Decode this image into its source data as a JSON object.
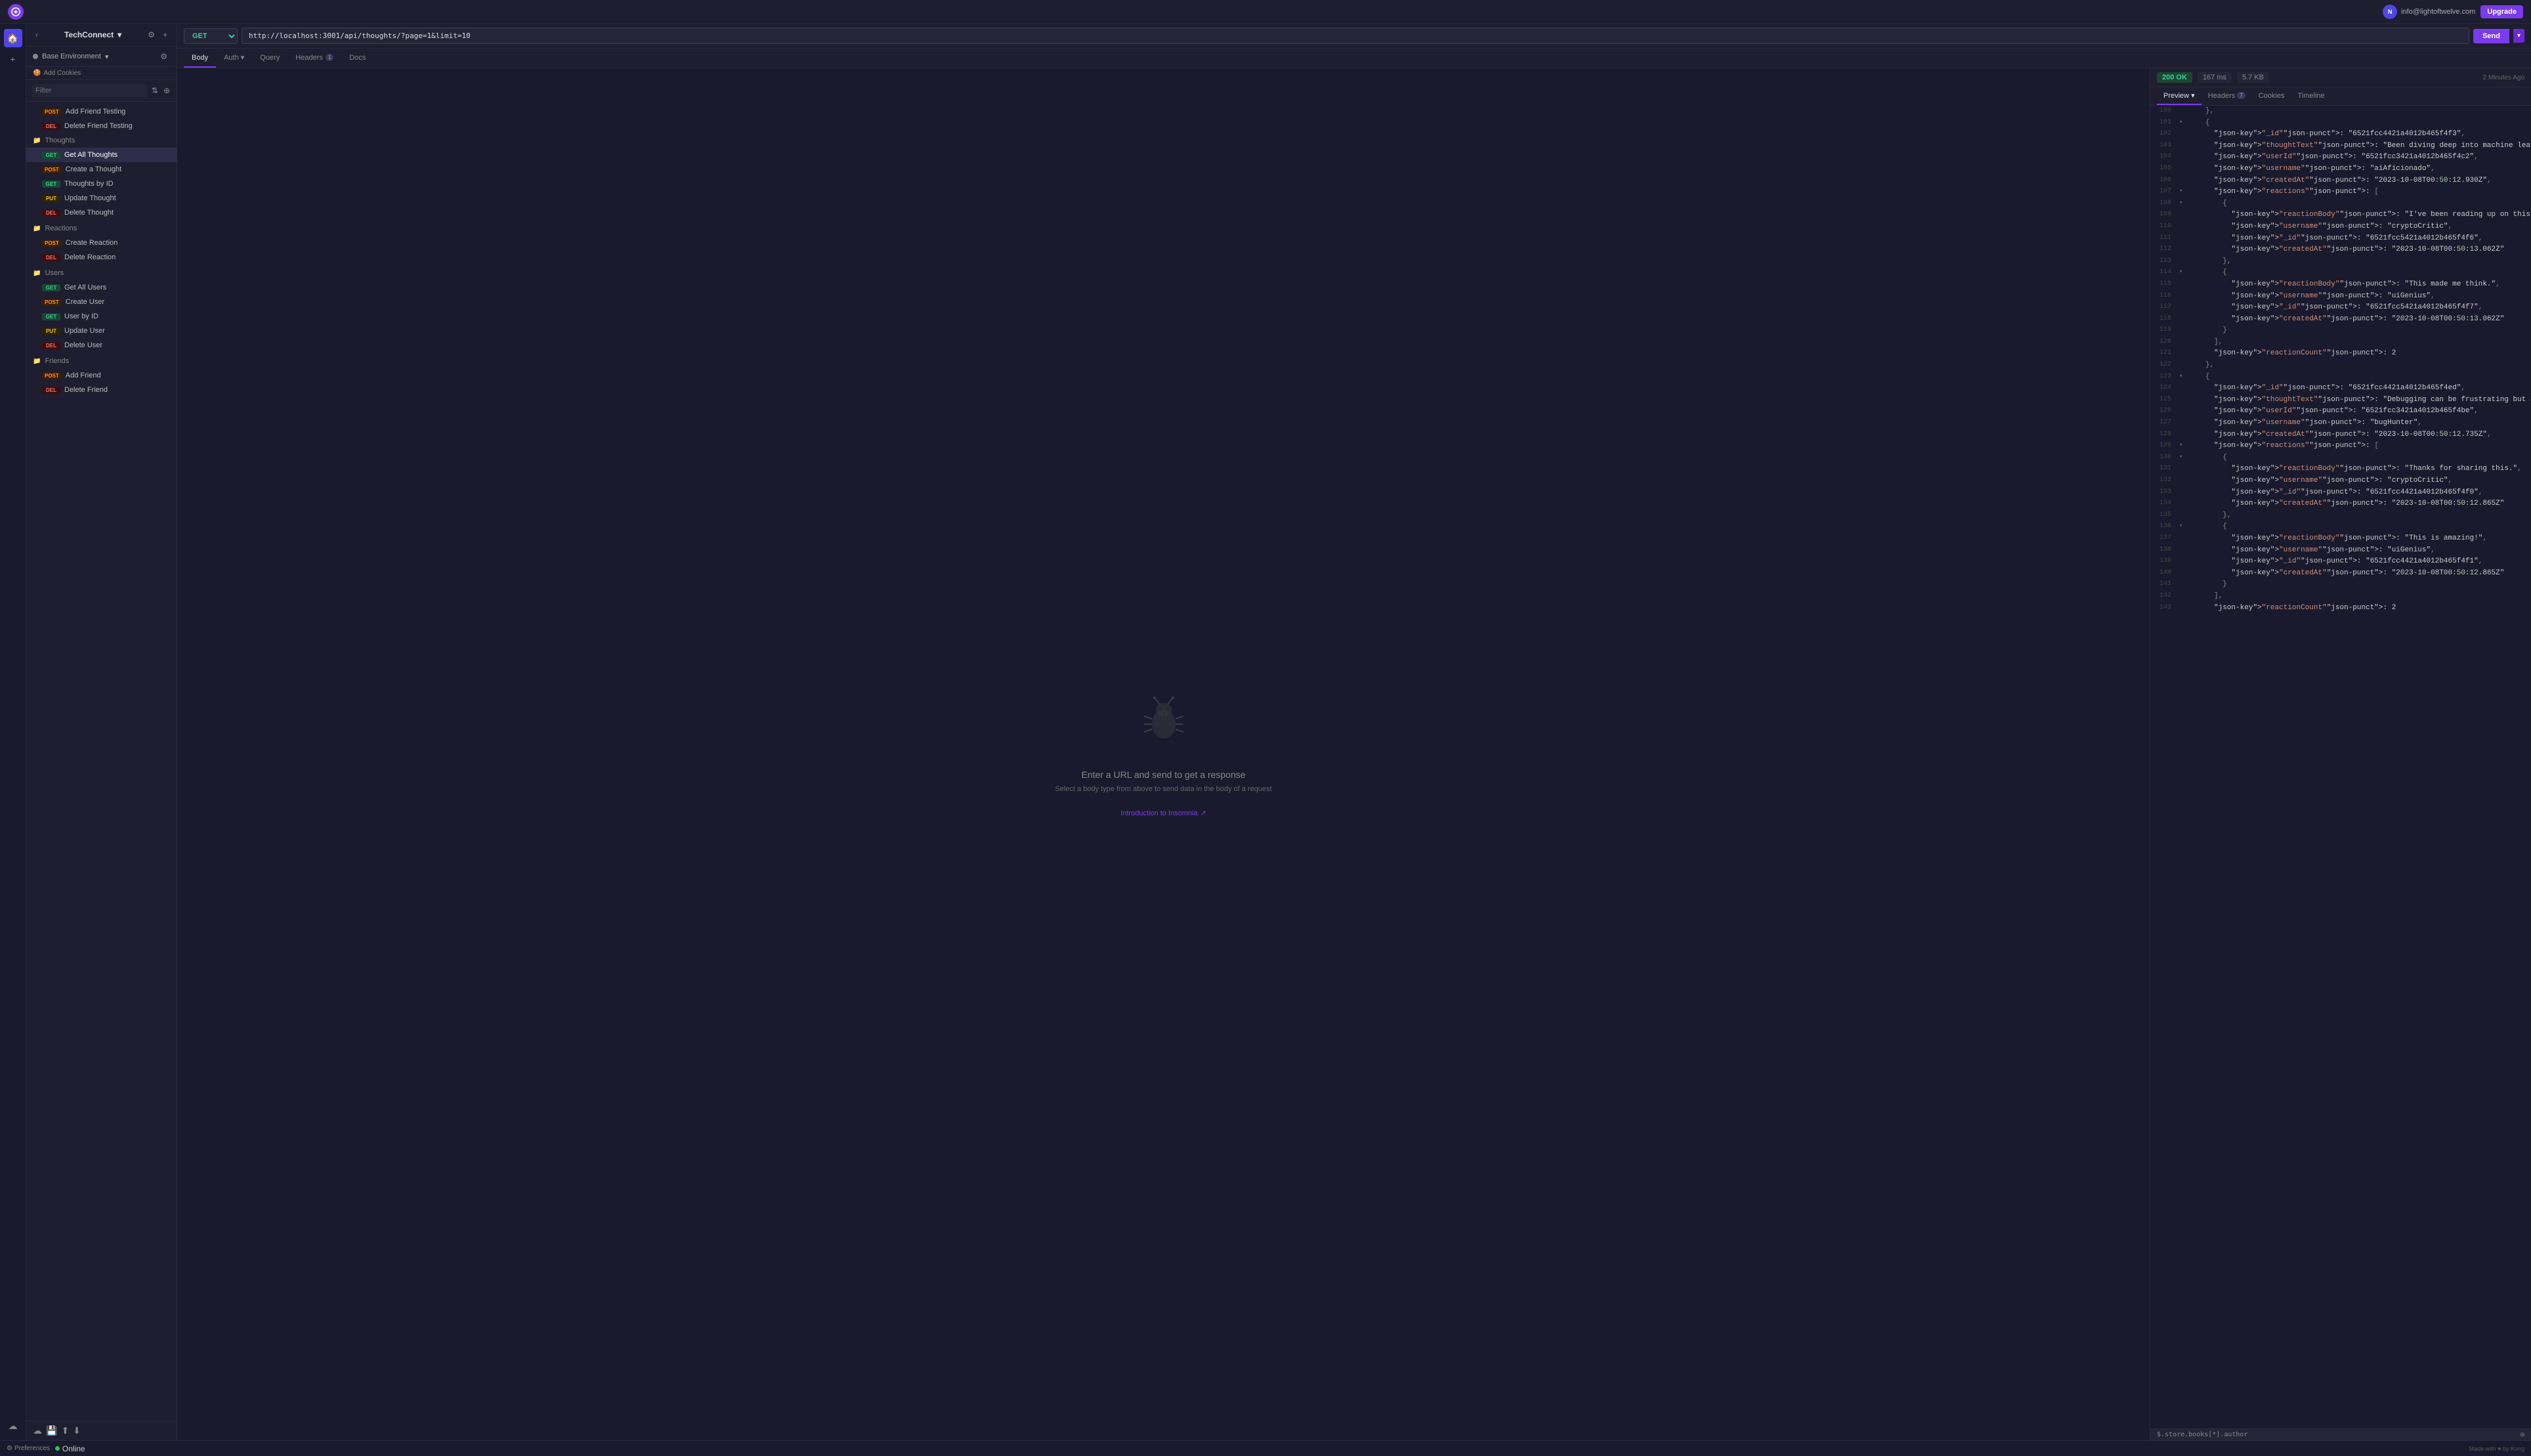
{
  "topbar": {
    "app_name": "Insomnia",
    "user_email": "info@lightoftwelve.com",
    "user_initials": "N",
    "upgrade_label": "Upgrade"
  },
  "sidebar": {
    "collection_name": "TechConnect",
    "back_label": "←",
    "env_label": "Base Environment",
    "add_cookies_label": "Add Cookies",
    "filter_placeholder": "Filter",
    "sections": [
      {
        "name": "Thoughts",
        "items": [
          {
            "method": "GET",
            "label": "Get All Thoughts",
            "active": true
          },
          {
            "method": "POST",
            "label": "Create a Thought"
          },
          {
            "method": "GET",
            "label": "Thoughts by ID"
          },
          {
            "method": "PUT",
            "label": "Update Thought"
          },
          {
            "method": "DEL",
            "label": "Delete Thought"
          }
        ]
      },
      {
        "name": "Reactions",
        "items": [
          {
            "method": "POST",
            "label": "Create Reaction"
          },
          {
            "method": "DEL",
            "label": "Delete Reaction"
          }
        ]
      },
      {
        "name": "Users",
        "items": [
          {
            "method": "GET",
            "label": "Get All Users"
          },
          {
            "method": "POST",
            "label": "Create User"
          },
          {
            "method": "GET",
            "label": "User by ID"
          },
          {
            "method": "PUT",
            "label": "Update User"
          },
          {
            "method": "DEL",
            "label": "Delete User"
          }
        ]
      },
      {
        "name": "Friends",
        "items": [
          {
            "method": "POST",
            "label": "Add Friend"
          },
          {
            "method": "DEL",
            "label": "Delete Friend"
          }
        ]
      }
    ],
    "extra_items": [
      {
        "method": "POST",
        "label": "Add Friend Testing"
      },
      {
        "method": "DEL",
        "label": "Delete Friend Testing"
      }
    ]
  },
  "request": {
    "method": "GET",
    "url": "http://localhost:3001/api/thoughts/?page=1&limit=10",
    "send_label": "Send",
    "tabs": [
      "Body",
      "Auth",
      "Query",
      "Headers",
      "Docs"
    ],
    "headers_count": "1"
  },
  "response": {
    "status": "200 OK",
    "time": "167 ms",
    "size": "5.7 KB",
    "timestamp": "2 Minutes Ago",
    "tabs": [
      "Preview",
      "Headers",
      "Cookies",
      "Timeline"
    ],
    "headers_count": "7",
    "empty_title": "Enter a URL and send to get a response",
    "empty_sub": "Select a body type from above to send data in the body of a request",
    "intro_link": "Introduction to Insomnia",
    "jsonpath": "$.store.books[*].author"
  },
  "statusbar": {
    "preferences_label": "Preferences",
    "online_label": "Online",
    "made_with": "Made with",
    "by_label": "by Kong"
  },
  "code_lines": [
    {
      "num": "100",
      "fold": false,
      "content": "    },"
    },
    {
      "num": "101",
      "fold": true,
      "content": "    {"
    },
    {
      "num": "102",
      "fold": false,
      "content": "      \"_id\": \"6521fcc4421a4012b465f4f3\","
    },
    {
      "num": "103",
      "fold": false,
      "content": "      \"thoughtText\": \"Been diving deep into machine learning lately. The potential of AI is both exciting and terrifying. Thoughts?\","
    },
    {
      "num": "104",
      "fold": false,
      "content": "      \"userId\": \"6521fcc3421a4012b465f4c2\","
    },
    {
      "num": "105",
      "fold": false,
      "content": "      \"username\": \"aiAficionado\","
    },
    {
      "num": "106",
      "fold": false,
      "content": "      \"createdAt\": \"2023-10-08T00:50:12.930Z\","
    },
    {
      "num": "107",
      "fold": true,
      "content": "      \"reactions\": ["
    },
    {
      "num": "108",
      "fold": true,
      "content": "        {"
    },
    {
      "num": "109",
      "fold": false,
      "content": "          \"reactionBody\": \"I've been reading up on this too.\","
    },
    {
      "num": "110",
      "fold": false,
      "content": "          \"username\": \"cryptoCritic\","
    },
    {
      "num": "111",
      "fold": false,
      "content": "          \"_id\": \"6521fcc5421a4012b465f4f6\","
    },
    {
      "num": "112",
      "fold": false,
      "content": "          \"createdAt\": \"2023-10-08T00:50:13.062Z\""
    },
    {
      "num": "113",
      "fold": false,
      "content": "        },"
    },
    {
      "num": "114",
      "fold": true,
      "content": "        {"
    },
    {
      "num": "115",
      "fold": false,
      "content": "          \"reactionBody\": \"This made me think.\","
    },
    {
      "num": "116",
      "fold": false,
      "content": "          \"username\": \"uiGenius\","
    },
    {
      "num": "117",
      "fold": false,
      "content": "          \"_id\": \"6521fcc5421a4012b465f4f7\","
    },
    {
      "num": "118",
      "fold": false,
      "content": "          \"createdAt\": \"2023-10-08T00:50:13.062Z\""
    },
    {
      "num": "119",
      "fold": false,
      "content": "        }"
    },
    {
      "num": "120",
      "fold": false,
      "content": "      ],"
    },
    {
      "num": "121",
      "fold": false,
      "content": "      \"reactionCount\": 2"
    },
    {
      "num": "122",
      "fold": false,
      "content": "    },"
    },
    {
      "num": "123",
      "fold": true,
      "content": "    {"
    },
    {
      "num": "124",
      "fold": false,
      "content": "      \"_id\": \"6521fcc4421a4012b465f4ed\","
    },
    {
      "num": "125",
      "fold": false,
      "content": "      \"thoughtText\": \"Debugging can be frustrating but also so rewarding when you finally solve the problem!\","
    },
    {
      "num": "126",
      "fold": false,
      "content": "      \"userId\": \"6521fcc3421a4012b465f4be\","
    },
    {
      "num": "127",
      "fold": false,
      "content": "      \"username\": \"bugHunter\","
    },
    {
      "num": "128",
      "fold": false,
      "content": "      \"createdAt\": \"2023-10-08T00:50:12.735Z\","
    },
    {
      "num": "129",
      "fold": true,
      "content": "      \"reactions\": ["
    },
    {
      "num": "130",
      "fold": true,
      "content": "        {"
    },
    {
      "num": "131",
      "fold": false,
      "content": "          \"reactionBody\": \"Thanks for sharing this.\","
    },
    {
      "num": "132",
      "fold": false,
      "content": "          \"username\": \"cryptoCritic\","
    },
    {
      "num": "133",
      "fold": false,
      "content": "          \"_id\": \"6521fcc4421a4012b465f4f0\","
    },
    {
      "num": "134",
      "fold": false,
      "content": "          \"createdAt\": \"2023-10-08T00:50:12.865Z\""
    },
    {
      "num": "135",
      "fold": false,
      "content": "        },"
    },
    {
      "num": "136",
      "fold": true,
      "content": "        {"
    },
    {
      "num": "137",
      "fold": false,
      "content": "          \"reactionBody\": \"This is amazing!\","
    },
    {
      "num": "138",
      "fold": false,
      "content": "          \"username\": \"uiGenius\","
    },
    {
      "num": "139",
      "fold": false,
      "content": "          \"_id\": \"6521fcc4421a4012b465f4f1\","
    },
    {
      "num": "140",
      "fold": false,
      "content": "          \"createdAt\": \"2023-10-08T00:50:12.865Z\""
    },
    {
      "num": "141",
      "fold": false,
      "content": "        }"
    },
    {
      "num": "142",
      "fold": false,
      "content": "      ],"
    },
    {
      "num": "143",
      "fold": false,
      "content": "      \"reactionCount\": 2"
    }
  ]
}
